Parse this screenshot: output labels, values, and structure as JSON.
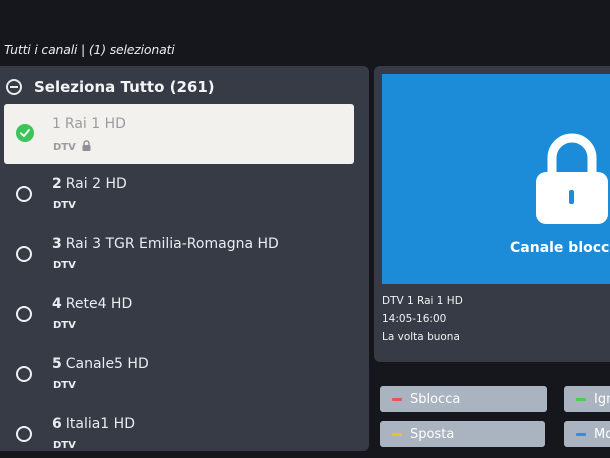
{
  "header": {
    "title": "Tutti i canali | (1) selezionati"
  },
  "list": {
    "select_all_label": "Seleziona Tutto (261)",
    "channels": [
      {
        "number": "1",
        "name": "Rai 1 HD",
        "type": "DTV",
        "selected": true,
        "locked": true
      },
      {
        "number": "2",
        "name": "Rai 2 HD",
        "type": "DTV",
        "selected": false,
        "locked": false
      },
      {
        "number": "3",
        "name": "Rai 3 TGR Emilia-Romagna HD",
        "type": "DTV",
        "selected": false,
        "locked": false
      },
      {
        "number": "4",
        "name": "Rete4 HD",
        "type": "DTV",
        "selected": false,
        "locked": false
      },
      {
        "number": "5",
        "name": "Canale5 HD",
        "type": "DTV",
        "selected": false,
        "locked": false
      },
      {
        "number": "6",
        "name": "Italia1 HD",
        "type": "DTV",
        "selected": false,
        "locked": false
      }
    ]
  },
  "preview": {
    "blocked_label": "Canale bloccato",
    "lock_icon": "lock-icon",
    "background_color": "#1c8bd8",
    "channel_info": "DTV 1  Rai 1 HD",
    "time": "14:05-16:00",
    "program": "La volta buona"
  },
  "buttons": {
    "unlock": {
      "label": "Sblocca",
      "color": "#e8535b"
    },
    "ignore": {
      "label": "Ignora",
      "color": "#4ccb4f"
    },
    "move": {
      "label": "Sposta",
      "color": "#f2c21b"
    },
    "modify": {
      "label": "Modifica",
      "color": "#2f8fe8"
    }
  },
  "colors": {
    "panel": "#363b45",
    "background": "#15171c",
    "check": "#3cc45a",
    "button": "#aab3c0"
  }
}
